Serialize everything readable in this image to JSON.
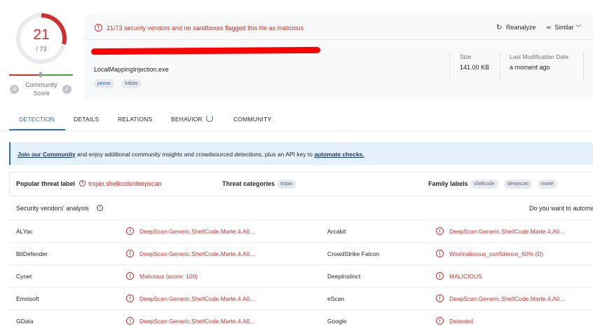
{
  "score": {
    "detections": "21",
    "total": "/ 73",
    "ratio": 0.2877,
    "ring_color": "#d12f2f"
  },
  "community": {
    "label_line1": "Community",
    "label_line2": "Score",
    "down_icon": "x-circle-icon",
    "up_icon": "check-circle-icon"
  },
  "alert": {
    "text": "21/73 security vendors and no sandboxes flagged this file as malicious",
    "icon": "alert-circle-icon"
  },
  "actions": {
    "reanalyze": "Reanalyze",
    "similar": "Similar"
  },
  "file": {
    "name": "LocalMappingInjection.exe",
    "tags": [
      "peexe",
      "64bits"
    ],
    "size_label": "Size",
    "size_value": "141.00 KB",
    "modified_label": "Last Modification Date",
    "modified_value": "a moment ago"
  },
  "tabs": [
    "DETECTION",
    "DETAILS",
    "RELATIONS",
    "BEHAVIOR",
    "COMMUNITY"
  ],
  "banner": {
    "link1": "Join our Community",
    "middle": " and enjoy additional community insights and crowdsourced detections, plus an API key to ",
    "link2": "automate checks."
  },
  "threat": {
    "popular_label": "Popular threat label",
    "popular_value": "trojan.shellcode/deepscan",
    "categories_label": "Threat categories",
    "categories": [
      "trojan"
    ],
    "family_label": "Family labels",
    "families": [
      "shellcode",
      "deepscan",
      "marte"
    ]
  },
  "vendors_section": {
    "title": "Security vendors' analysis",
    "right_text": "Do you want to automa"
  },
  "vendors": [
    {
      "left_name": "ALYac",
      "left_result": "DeepScan:Generic.ShellCode.Marte.4.A0...",
      "right_name": "Arcabit",
      "right_result": "DeepScan:Generic.ShellCode.Marte.4.A0..."
    },
    {
      "left_name": "BitDefender",
      "left_result": "DeepScan:Generic.ShellCode.Marte.4.A0...",
      "right_name": "CrowdStrike Falcon",
      "right_result": "Win/malicious_confidence_60% (D)"
    },
    {
      "left_name": "Cynet",
      "left_result": "Malicious (score: 100)",
      "right_name": "DeepInstinct",
      "right_result": "MALICIOUS"
    },
    {
      "left_name": "Emsisoft",
      "left_result": "DeepScan:Generic.ShellCode.Marte.4.A0...",
      "right_name": "eScan",
      "right_result": "DeepScan:Generic.ShellCode.Marte.4.A0..."
    },
    {
      "left_name": "GData",
      "left_result": "DeepScan:Generic.ShellCode.Marte.4.A0...",
      "right_name": "Google",
      "right_result": "Detected"
    }
  ],
  "colors": {
    "accent": "#2f6fb5",
    "danger": "#d12f2f",
    "good": "#3fa54a"
  }
}
